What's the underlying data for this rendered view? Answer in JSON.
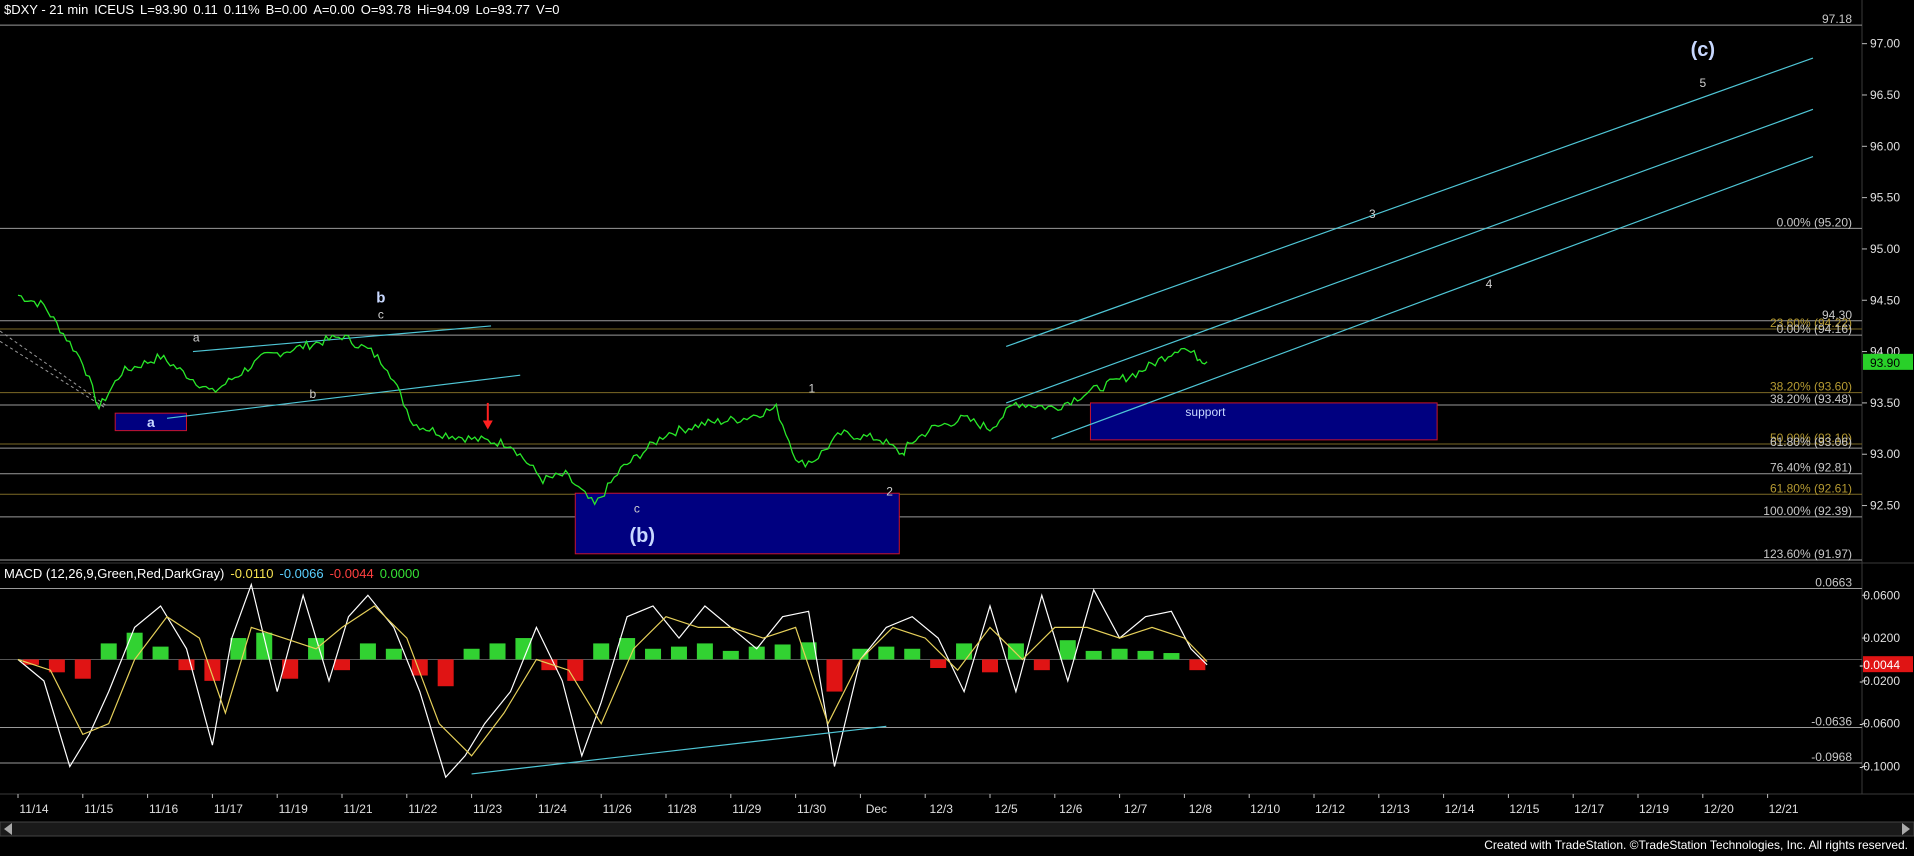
{
  "header": {
    "symbol": "$DXY - 21 min",
    "exchange": "ICEUS",
    "last": "L=93.90",
    "change": "0.11",
    "change_pct": "0.11%",
    "bid": "B=0.00",
    "ask": "A=0.00",
    "open": "O=93.78",
    "high": "Hi=94.09",
    "low": "Lo=93.77",
    "volume": "V=0"
  },
  "macd_header": {
    "title": "MACD (12,26,9,Green,Red,DarkGray)",
    "v1": "-0.0110",
    "v2": "-0.0066",
    "v3": "-0.0044",
    "v4": "0.0000"
  },
  "credit": "Created with TradeStation. ©TradeStation Technologies, Inc. All rights reserved.",
  "colors": {
    "price": "#29e829",
    "trend": "#4fc6d6",
    "box_fill": "#000080",
    "box_border": "#c8142c",
    "fib_gray": "#c8c8c8",
    "fib_gold": "#b59a32",
    "macd_green": "#32d232",
    "macd_red": "#e01414",
    "macd_line": "#ffffff",
    "signal_line": "#e6d05a"
  },
  "chart_data": [
    {
      "type": "line",
      "title": "$DXY - 21 min",
      "x_labels": [
        "11/14",
        "11/15",
        "11/16",
        "11/17",
        "11/19",
        "11/21",
        "11/22",
        "11/23",
        "11/24",
        "11/26",
        "11/28",
        "11/29",
        "11/30",
        "Dec",
        "12/3",
        "12/5",
        "12/6",
        "12/7",
        "12/8",
        "12/10",
        "12/12",
        "12/13",
        "12/14",
        "12/15",
        "12/17",
        "12/19",
        "12/20",
        "12/21"
      ],
      "y_ticks": [
        92.5,
        93.0,
        93.5,
        94.0,
        94.5,
        95.0,
        95.5,
        96.0,
        96.5,
        97.0
      ],
      "ylim": [
        91.95,
        97.25
      ],
      "last_price": "93.90",
      "series": [
        {
          "x": [
            0,
            0.4,
            1.0,
            1.25,
            1.6,
            2.2,
            3.0,
            3.8,
            4.4,
            5.0,
            5.45,
            5.7,
            6.1,
            6.55,
            7.0,
            7.6,
            8.1,
            8.45,
            8.9,
            9.3,
            9.6,
            10.0,
            10.6,
            11.2,
            11.7,
            12.05,
            12.3,
            12.7,
            13.3,
            13.65,
            13.75,
            14.1,
            14.6,
            15.0,
            15.4,
            16.0,
            16.5,
            16.9,
            17.3,
            17.7,
            17.95,
            18.2,
            18.35
          ],
          "values": [
            94.55,
            94.45,
            93.9,
            93.45,
            93.8,
            93.95,
            93.6,
            93.95,
            94.05,
            94.15,
            94.0,
            93.85,
            93.3,
            93.2,
            93.15,
            93.1,
            92.75,
            92.8,
            92.5,
            92.85,
            93.0,
            93.2,
            93.3,
            93.35,
            93.45,
            92.9,
            92.95,
            93.2,
            93.15,
            93.0,
            93.1,
            93.25,
            93.35,
            93.25,
            93.5,
            93.45,
            93.6,
            93.7,
            93.8,
            93.95,
            94.05,
            93.95,
            93.9
          ]
        }
      ],
      "horizontal_levels": [
        {
          "value": 97.18,
          "label": "97.18",
          "style": "gray"
        },
        {
          "value": 95.2,
          "label": "0.00% (95.20)",
          "style": "gray"
        },
        {
          "value": 94.3,
          "label": "94.30",
          "style": "gray"
        },
        {
          "value": 94.22,
          "label": "23.60% (94.22)",
          "style": "gold"
        },
        {
          "value": 94.16,
          "label": "0.00% (94.16)",
          "style": "gray"
        },
        {
          "value": 93.6,
          "label": "38.20% (93.60)",
          "style": "gold"
        },
        {
          "value": 93.48,
          "label": "38.20% (93.48)",
          "style": "gray"
        },
        {
          "value": 93.1,
          "label": "50.00% (93.10)",
          "style": "gold"
        },
        {
          "value": 93.06,
          "label": "61.80% (93.06)",
          "style": "gray"
        },
        {
          "value": 92.81,
          "label": "76.40% (92.81)",
          "style": "gray"
        },
        {
          "value": 92.61,
          "label": "61.80% (92.61)",
          "style": "gold"
        },
        {
          "value": 92.39,
          "label": "100.00% (92.39)",
          "style": "gray"
        },
        {
          "value": 91.97,
          "label": "123.60% (91.97)",
          "style": "gray"
        }
      ],
      "boxes": [
        {
          "x0": 1.5,
          "x1": 2.6,
          "y0": 93.4,
          "y1": 93.23,
          "label": "a"
        },
        {
          "x0": 8.6,
          "x1": 13.6,
          "y0": 92.62,
          "y1": 92.03,
          "label": "(b)"
        },
        {
          "x0": 16.55,
          "x1": 21.9,
          "y0": 93.5,
          "y1": 93.14,
          "label": "support"
        }
      ],
      "trend_lines": [
        {
          "x0": 2.7,
          "y0": 94.0,
          "x1": 7.3,
          "y1": 94.25
        },
        {
          "x0": 2.3,
          "y0": 93.35,
          "x1": 7.75,
          "y1": 93.77
        },
        {
          "x0": 15.25,
          "y0": 94.05,
          "x1": 27.7,
          "y1": 96.86
        },
        {
          "x0": 15.25,
          "y0": 93.5,
          "x1": 27.7,
          "y1": 96.36
        },
        {
          "x0": 15.95,
          "y0": 93.15,
          "x1": 27.7,
          "y1": 95.9
        }
      ],
      "wave_labels": [
        {
          "text": "a",
          "x": 2.75,
          "y": 94.1
        },
        {
          "text": "b",
          "x": 4.55,
          "y": 93.55
        },
        {
          "text": "c",
          "x": 5.6,
          "y": 94.32
        },
        {
          "text": "b",
          "x": 5.6,
          "y": 94.48
        },
        {
          "text": "c",
          "x": 9.55,
          "y": 92.43
        },
        {
          "text": "1",
          "x": 12.25,
          "y": 93.6
        },
        {
          "text": "2",
          "x": 13.45,
          "y": 92.6
        },
        {
          "text": "3",
          "x": 20.9,
          "y": 95.3
        },
        {
          "text": "4",
          "x": 22.7,
          "y": 94.62
        },
        {
          "text": "5",
          "x": 26.0,
          "y": 96.58
        },
        {
          "text": "(c)",
          "x": 26.0,
          "y": 96.88
        }
      ],
      "arrow_down": {
        "x": 7.25,
        "y_from": 93.5,
        "y_to": 93.27
      }
    },
    {
      "type": "line",
      "title": "MACD (12,26,9,Green,Red,DarkGray)",
      "y_ticks": [
        0.06,
        0.02,
        -0.02,
        -0.06,
        -0.1
      ],
      "ylim": [
        -0.122,
        0.078
      ],
      "last_value": "-0.0044",
      "horizontal_levels": [
        {
          "value": 0.0663,
          "label": "0.0663"
        },
        {
          "value": -0.0636,
          "label": "-0.0636"
        },
        {
          "value": -0.0968,
          "label": "-0.0968"
        }
      ],
      "trend_line": {
        "x0": 7.0,
        "y0": -0.107,
        "x1": 13.4,
        "y1": -0.0625
      },
      "series": [
        {
          "name": "MACD",
          "x": [
            0,
            0.4,
            0.8,
            1.1,
            1.4,
            1.8,
            2.2,
            2.6,
            3.0,
            3.3,
            3.6,
            4.0,
            4.4,
            4.8,
            5.1,
            5.4,
            5.8,
            6.2,
            6.6,
            6.9,
            7.2,
            7.6,
            8.0,
            8.4,
            8.7,
            9.0,
            9.4,
            9.8,
            10.2,
            10.6,
            11.0,
            11.4,
            11.8,
            12.2,
            12.6,
            13.0,
            13.4,
            13.8,
            14.2,
            14.6,
            15.0,
            15.4,
            15.8,
            16.2,
            16.6,
            17.0,
            17.4,
            17.8,
            18.1,
            18.35
          ],
          "values": [
            0.0,
            -0.02,
            -0.1,
            -0.07,
            -0.03,
            0.03,
            0.05,
            0.01,
            -0.08,
            0.02,
            0.07,
            -0.03,
            0.06,
            -0.02,
            0.04,
            0.06,
            0.03,
            -0.03,
            -0.11,
            -0.09,
            -0.06,
            -0.03,
            0.03,
            -0.02,
            -0.09,
            -0.04,
            0.04,
            0.05,
            0.02,
            0.05,
            0.03,
            0.01,
            0.04,
            0.045,
            -0.1,
            0.0,
            0.03,
            0.04,
            0.02,
            -0.03,
            0.05,
            -0.03,
            0.06,
            -0.02,
            0.065,
            0.02,
            0.04,
            0.045,
            0.01,
            -0.005
          ]
        },
        {
          "name": "Signal",
          "x": [
            0,
            0.5,
            1.0,
            1.4,
            1.8,
            2.3,
            2.8,
            3.2,
            3.6,
            4.1,
            4.6,
            5.0,
            5.5,
            6.0,
            6.5,
            7.0,
            7.5,
            8.0,
            8.5,
            9.0,
            9.5,
            10.0,
            10.5,
            11.0,
            11.5,
            12.0,
            12.5,
            13.0,
            13.5,
            14.0,
            14.5,
            15.0,
            15.5,
            16.0,
            16.5,
            17.0,
            17.5,
            18.0,
            18.35
          ],
          "values": [
            0.0,
            -0.01,
            -0.07,
            -0.06,
            0.0,
            0.04,
            0.02,
            -0.05,
            0.03,
            0.02,
            0.01,
            0.03,
            0.05,
            0.02,
            -0.06,
            -0.09,
            -0.05,
            0.0,
            -0.01,
            -0.06,
            0.01,
            0.04,
            0.03,
            0.03,
            0.02,
            0.03,
            -0.06,
            0.0,
            0.03,
            0.02,
            -0.01,
            0.03,
            0.0,
            0.03,
            0.03,
            0.02,
            0.03,
            0.02,
            -0.002
          ]
        }
      ],
      "histogram": {
        "x": [
          0.2,
          0.6,
          1.0,
          1.4,
          1.8,
          2.2,
          2.6,
          3.0,
          3.4,
          3.8,
          4.2,
          4.6,
          5.0,
          5.4,
          5.8,
          6.2,
          6.6,
          7.0,
          7.4,
          7.8,
          8.2,
          8.6,
          9.0,
          9.4,
          9.8,
          10.2,
          10.6,
          11.0,
          11.4,
          11.8,
          12.2,
          12.6,
          13.0,
          13.4,
          13.8,
          14.2,
          14.6,
          15.0,
          15.4,
          15.8,
          16.2,
          16.6,
          17.0,
          17.4,
          17.8,
          18.2
        ],
        "values": [
          -0.005,
          -0.012,
          -0.018,
          0.015,
          0.025,
          0.012,
          -0.01,
          -0.02,
          0.02,
          0.025,
          -0.018,
          0.02,
          -0.01,
          0.015,
          0.01,
          -0.015,
          -0.025,
          0.01,
          0.015,
          0.02,
          -0.01,
          -0.02,
          0.015,
          0.02,
          0.01,
          0.012,
          0.015,
          0.008,
          0.012,
          0.014,
          0.016,
          -0.03,
          0.01,
          0.012,
          0.01,
          -0.008,
          0.015,
          -0.012,
          0.015,
          -0.01,
          0.018,
          0.008,
          0.01,
          0.008,
          0.006,
          -0.01
        ]
      }
    }
  ]
}
